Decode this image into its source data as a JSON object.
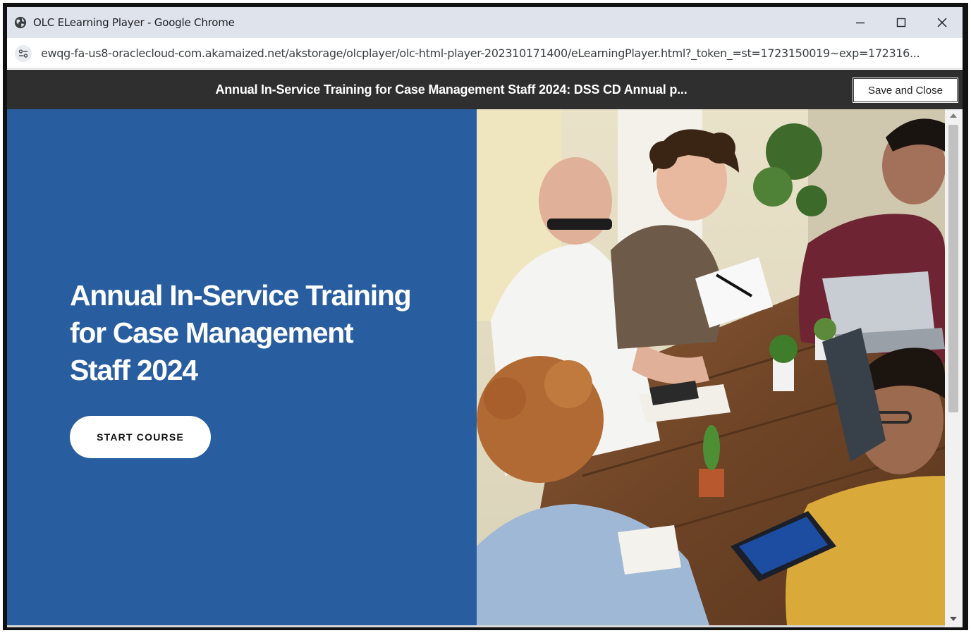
{
  "browser": {
    "window_title": "OLC ELearning Player - Google Chrome",
    "url": "ewqg-fa-us8-oraclecloud-com.akamaized.net/akstorage/olcplayer/olc-html-player-202310171400/eLearningPlayer.html?_token_=st=1723150019~exp=172316...",
    "icons": {
      "favicon": "globe-icon",
      "site_settings": "tune-icon",
      "minimize": "minimize-icon",
      "maximize": "maximize-icon",
      "close": "close-icon"
    }
  },
  "player": {
    "header_title": "Annual In-Service Training for Case Management Staff 2024: DSS CD Annual p...",
    "save_close_label": "Save and Close"
  },
  "hero": {
    "title_lines": [
      "Annual In-Service Training",
      "for Case Management",
      "Staff 2024"
    ],
    "start_button_label": "START COURSE",
    "photo": "team-meeting-photo"
  },
  "colors": {
    "hero_blue": "#285ea0",
    "header_dark": "#2f2f2f",
    "titlebar": "#dee3ec"
  }
}
